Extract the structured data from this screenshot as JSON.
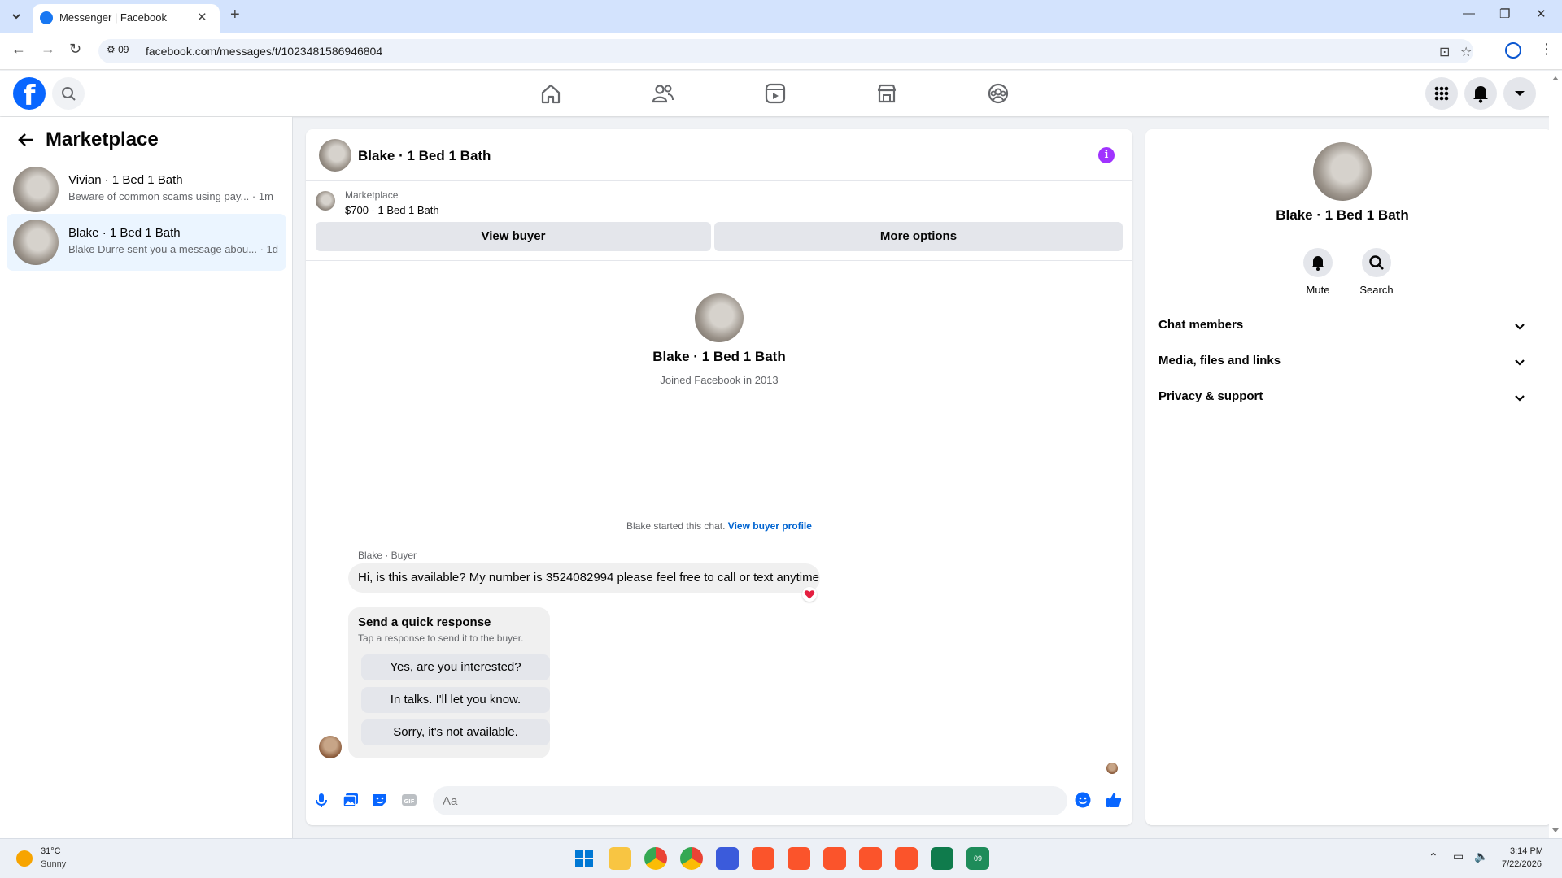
{
  "browser": {
    "tab_title": "Messenger | Facebook",
    "site_info": "09",
    "url": "facebook.com/messages/t/1023481586946804"
  },
  "icons": {
    "tab_favicon": "facebook-icon",
    "new_tab": "plus-icon",
    "back": "arrow-left-icon",
    "forward": "arrow-right-icon",
    "reload": "reload-icon",
    "install": "install-icon",
    "bookmark": "star-icon",
    "profile": "profile-icon",
    "browser_menu": "kebab-icon",
    "fb_home": "home-icon",
    "fb_friends": "friends-icon",
    "fb_video": "video-icon",
    "fb_marketplace": "marketplace-icon",
    "fb_groups": "groups-icon",
    "fb_menu": "grid-icon",
    "fb_notifications": "bell-icon",
    "fb_account": "caret-down-icon"
  },
  "colors": {
    "brand": "#0866ff",
    "info_accent": "#a033ff",
    "active_conversation": "#ebf5ff",
    "reaction": "#e41e3f"
  },
  "sidebar": {
    "title": "Marketplace",
    "conversations": [
      {
        "name": "Vivian · 1 Bed 1 Bath",
        "snippet": "Beware of common scams using pay...",
        "time": "· 1m",
        "active": false
      },
      {
        "name": "Blake · 1 Bed 1 Bath",
        "snippet": "Blake Durre sent you a message abou...",
        "time": "· 1d",
        "active": true
      }
    ]
  },
  "chat": {
    "header_title": "Blake · 1 Bed 1 Bath",
    "marketplace_label": "Marketplace",
    "listing": "$700 - 1 Bed 1 Bath",
    "view_buyer": "View buyer",
    "more_options": "More options",
    "profile_name": "Blake · 1 Bed 1 Bath",
    "joined": "Joined Facebook in 2013",
    "started_text": "Blake started this chat.",
    "view_buyer_profile": "View buyer profile",
    "sender_label": "Blake · Buyer",
    "message": "Hi, is this available? My number is 3524082994 please feel free to call or text anytime",
    "reaction": "❤️",
    "quick_response_title": "Send a quick response",
    "quick_response_sub": "Tap a response to send it to the buyer.",
    "quick_responses": [
      "Yes, are you interested?",
      "In talks. I'll let you know.",
      "Sorry, it's not available."
    ],
    "composer_placeholder": "Aa"
  },
  "info_panel": {
    "name": "Blake · 1 Bed 1 Bath",
    "actions": [
      {
        "label": "Mute",
        "icon": "bell-icon"
      },
      {
        "label": "Search",
        "icon": "search-icon"
      }
    ],
    "sections": [
      "Chat members",
      "Media, files and links",
      "Privacy & support"
    ]
  },
  "taskbar": {
    "temperature": "31°C",
    "weather": "Sunny",
    "time": "3:14 PM",
    "date": "7/22/2026",
    "active_app_label": "09"
  }
}
